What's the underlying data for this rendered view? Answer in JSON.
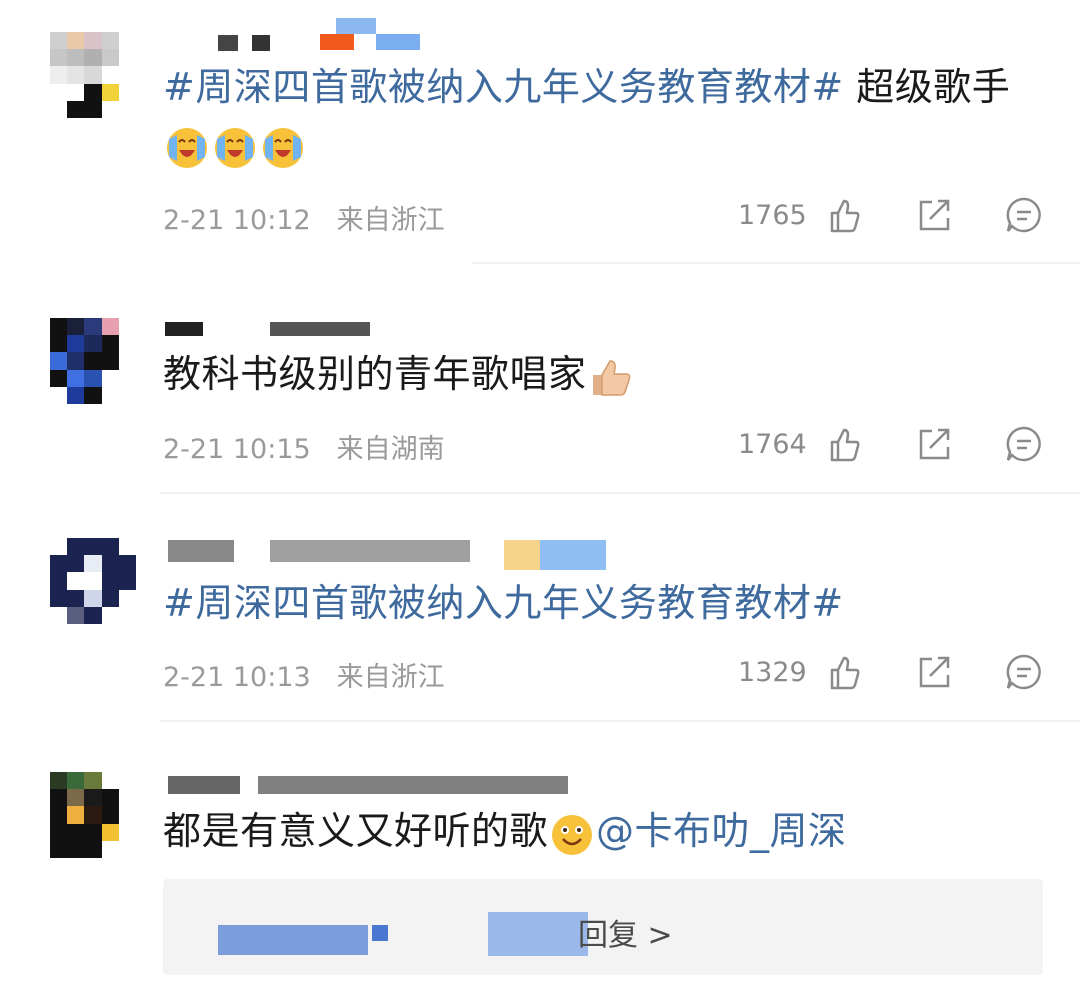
{
  "comments": [
    {
      "topic": "#周深四首歌被纳入九年义务教育教材#",
      "body": " 超级歌手",
      "time": "2-21 10:12",
      "location": "来自浙江",
      "likes": "1765",
      "emojis": [
        "crying-laugh-emoji",
        "crying-laugh-emoji",
        "crying-laugh-emoji"
      ]
    },
    {
      "body": "教科书级别的青年歌唱家",
      "time": "2-21 10:15",
      "location": "来自湖南",
      "likes": "1764",
      "emojis": [
        "thumbs-up-emoji"
      ]
    },
    {
      "topic": "#周深四首歌被纳入九年义务教育教材#",
      "time": "2-21 10:13",
      "location": "来自浙江",
      "likes": "1329"
    },
    {
      "body": "都是有意义又好听的歌",
      "mention": "@卡布叻_周深",
      "emojis": [
        "smiling-emoji"
      ]
    }
  ],
  "replies": {
    "label": "回复 >"
  },
  "colors": {
    "link": "#3f6a9e",
    "meta": "#9a9a9a",
    "divider": "#f0f0f0"
  },
  "icons": [
    "thumbs-up-icon",
    "share-icon",
    "comment-icon"
  ]
}
